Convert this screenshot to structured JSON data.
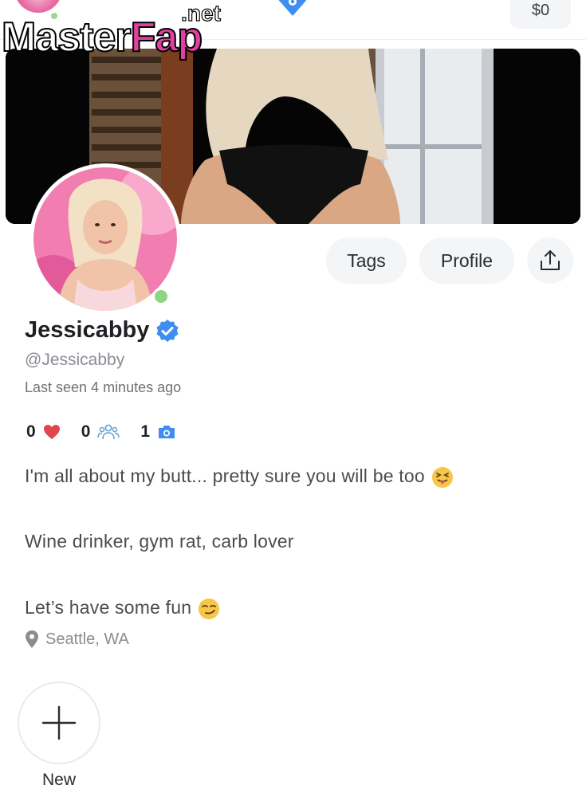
{
  "watermark": {
    "brand": "MasterFap",
    "brand_left": "Master",
    "brand_right": "Fap",
    "tld": ".net"
  },
  "topbar": {
    "balance": "$0"
  },
  "actions": {
    "tags_label": "Tags",
    "profile_label": "Profile",
    "share_icon": "share-upload-icon"
  },
  "profile": {
    "display_name": "Jessicabby",
    "handle": "@Jessicabby",
    "last_seen": "Last seen 4 minutes ago",
    "online": true,
    "verified": true
  },
  "stats": {
    "likes": "0",
    "fans": "0",
    "media": "1",
    "icons": [
      "heart-icon",
      "people-icon",
      "camera-icon"
    ]
  },
  "bio": {
    "line1": "I'm all about my butt... pretty sure you will be too",
    "line2": "Wine drinker, gym rat, carb lover",
    "line3": "Let’s have some fun"
  },
  "location": "Seattle, WA",
  "new_story": {
    "label": "New"
  },
  "colors": {
    "accent": "#1da1f2",
    "verified": "#3d8ef0",
    "online": "#8fd47f",
    "heart": "#e0474c",
    "stat_icon": "#5aa0d8"
  }
}
